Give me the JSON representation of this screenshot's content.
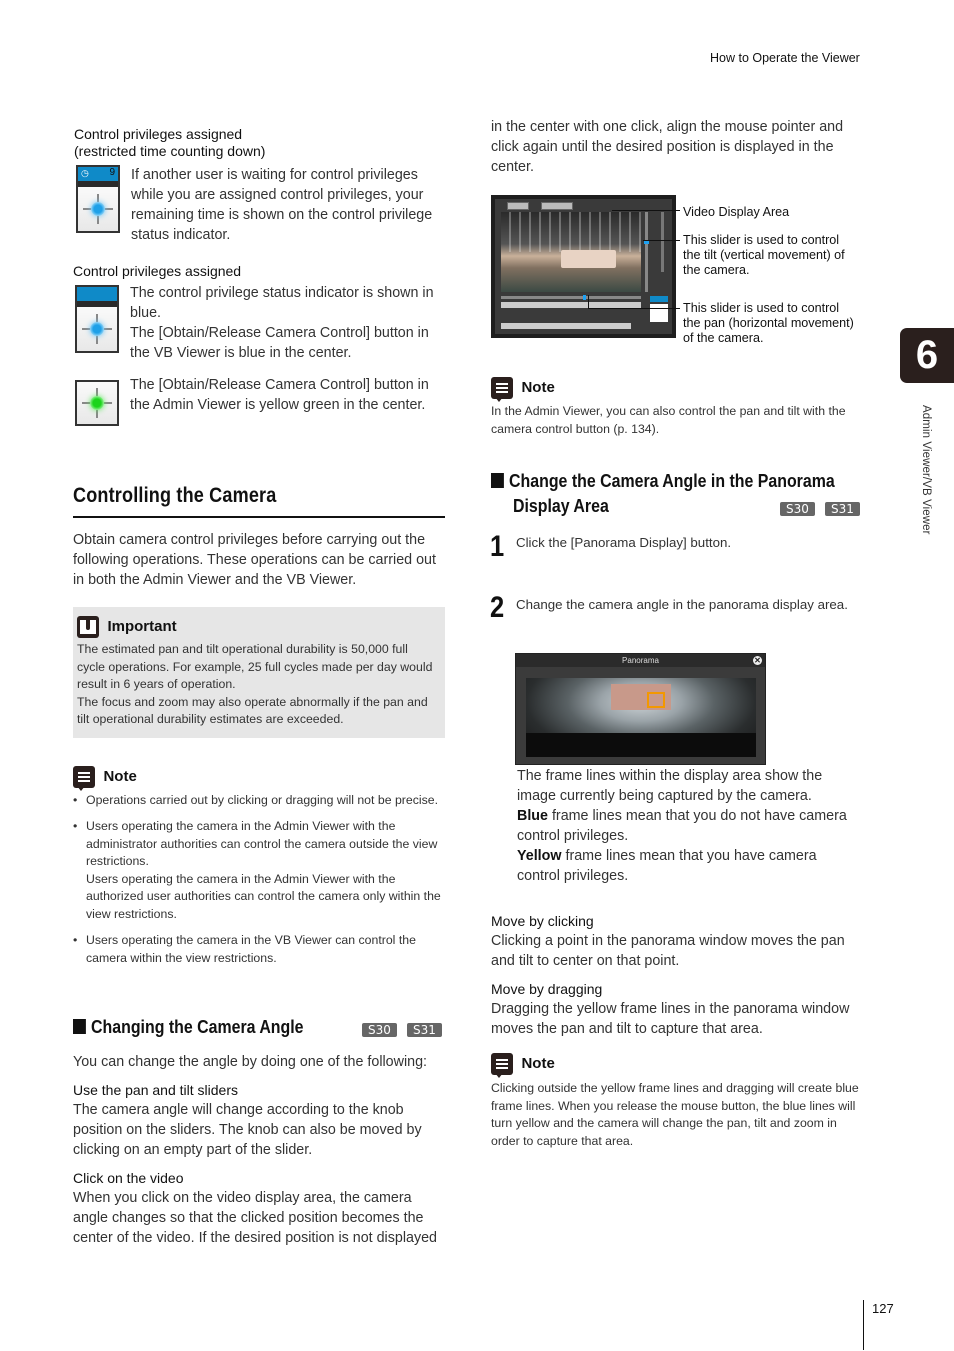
{
  "header": {
    "running_head": "How to Operate the Viewer"
  },
  "side_tab": {
    "chapter_number": "6",
    "chapter_label": "Admin Viewer/VB Viewer"
  },
  "footer": {
    "page_number": "127"
  },
  "left_column": {
    "privileges": [
      {
        "label_line1": "Control privileges assigned",
        "label_line2": "(restricted time counting down)",
        "icon": "privilege-indicator-countdown-icon",
        "countdown": "9",
        "text": "If another user is waiting for control privileges while you are assigned control privileges, your remaining time is shown on the control privilege status indicator."
      },
      {
        "label_line1": "Control privileges assigned",
        "icon": "privilege-indicator-blue-icon",
        "text_p1": "The control privilege status indicator is shown in blue.",
        "text_p2": "The [Obtain/Release Camera Control] button in the VB Viewer is blue in the center."
      },
      {
        "icon": "camera-control-button-green-icon",
        "text": "The [Obtain/Release Camera Control] button in the Admin Viewer is yellow green in the center."
      }
    ],
    "section_title": "Controlling the Camera",
    "section_intro": "Obtain camera control privileges before carrying out the following operations. These operations can be carried out in both the Admin Viewer and the VB Viewer.",
    "important": {
      "heading": "Important",
      "p1": "The estimated pan and tilt operational durability is 50,000 full cycle operations. For example, 25 full cycles made per day would result in 6 years of operation.",
      "p2": "The focus and zoom may also operate abnormally if the pan and tilt operational durability estimates are exceeded."
    },
    "note": {
      "heading": "Note",
      "bullets": [
        {
          "text": "Operations carried out by clicking or dragging will not be precise."
        },
        {
          "text": "Users operating the camera in the Admin Viewer with the administrator authorities can control the camera outside the view restrictions.",
          "text2": "Users operating the camera in the Admin Viewer with the authorized user authorities can control the camera only within the view restrictions."
        },
        {
          "text": "Users operating the camera in the VB Viewer can control the camera within the view restrictions."
        }
      ]
    },
    "subsection": {
      "title": "Changing the Camera Angle",
      "badges": [
        "S30",
        "S31"
      ],
      "intro": "You can change the angle by doing one of the following:",
      "method1_title": "Use the pan and tilt sliders",
      "method1_text": "The camera angle will change according to the knob position on the sliders. The knob can also be moved by clicking on an empty part of the slider.",
      "method2_title": "Click on the video",
      "method2_text": "When you click on the video display area, the camera angle changes so that the clicked position becomes the center of the video. If the desired position is not displayed"
    }
  },
  "right_column": {
    "continuation": "in the center with one click, align the mouse pointer and click again until the desired position is displayed in the center.",
    "viewer_callouts": {
      "video_area": "Video Display Area",
      "tilt_slider": "This slider is used to control the tilt (vertical movement) of the camera.",
      "pan_slider": "This slider is used to control the pan (horizontal movement) of the camera."
    },
    "note1": {
      "heading": "Note",
      "text": "In the Admin Viewer, you can also control the pan and tilt with the camera control button (p. 134)."
    },
    "subsection": {
      "title_line1": "Change the Camera Angle in the Panorama",
      "title_line2": "Display Area",
      "badges": [
        "S30",
        "S31"
      ]
    },
    "steps": [
      {
        "number": "1",
        "text": "Click the [Panorama Display] button."
      },
      {
        "number": "2",
        "text": "Change the camera angle in the panorama display area."
      }
    ],
    "panorama_window": {
      "title": "Panorama",
      "close_glyph": "✕"
    },
    "frame_desc": {
      "p1": "The frame lines within the display area show the image currently being captured by the camera.",
      "blue_bold": "Blue",
      "blue_rest": " frame lines mean that you do not have camera control privileges.",
      "yellow_bold": "Yellow",
      "yellow_rest": " frame lines mean that you have camera control privileges."
    },
    "move_click": {
      "title": "Move by clicking",
      "text": "Clicking a point in the panorama window moves the pan and tilt to center on that point."
    },
    "move_drag": {
      "title": "Move by dragging",
      "text": "Dragging the yellow frame lines in the panorama window moves the pan and tilt to capture that area."
    },
    "note2": {
      "heading": "Note",
      "text": "Clicking outside the yellow frame lines and dragging will create blue frame lines. When you release the mouse button, the blue lines will turn yellow and the camera will change the pan, tilt and zoom in order to capture that area."
    }
  }
}
